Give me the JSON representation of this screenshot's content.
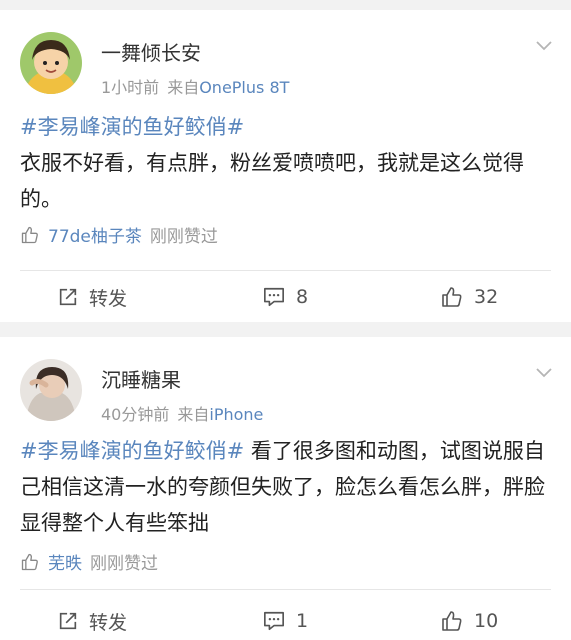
{
  "posts": [
    {
      "username": "一舞倾长安",
      "time": "1小时前",
      "from_label": "来自",
      "source": "OnePlus 8T",
      "topic": "#李易峰演的鱼好鲛俏#",
      "text": "衣服不好看，有点胖，粉丝爱喷喷吧，我就是这么觉得的。",
      "liker": "77de柚子茶",
      "liked_when": "刚刚赞过",
      "repost_label": "转发",
      "comments": "8",
      "likes": "32"
    },
    {
      "username": "沉睡糖果",
      "time": "40分钟前",
      "from_label": "来自",
      "source": "iPhone",
      "topic": "#李易峰演的鱼好鲛俏#",
      "text": " 看了很多图和动图，试图说服自己相信这清一水的夸颜但失败了，脸怎么看怎么胖，胖脸显得整个人有些笨拙",
      "liker": "芜昳",
      "liked_when": "刚刚赞过",
      "repost_label": "转发",
      "comments": "1",
      "likes": "10"
    }
  ],
  "icons": {
    "repost": "share-square-icon",
    "comment": "comment-bubble-icon",
    "like": "thumbs-up-icon",
    "menu": "chevron-down-icon"
  },
  "colors": {
    "link": "#5a86bd",
    "meta": "#999999",
    "background": "#f2f2f2"
  }
}
